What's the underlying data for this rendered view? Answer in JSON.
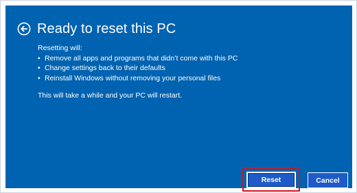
{
  "header": {
    "back_icon": "back-arrow-circle-icon",
    "title": "Ready to reset this PC"
  },
  "content": {
    "intro": "Resetting will:",
    "items": [
      "Remove all apps and programs that didn’t come with this PC",
      "Change settings back to their defaults",
      "Reinstall Windows without removing your personal files"
    ],
    "note": "This will take a while and your PC will restart."
  },
  "actions": {
    "reset_label": "Reset",
    "cancel_label": "Cancel"
  },
  "colors": {
    "panel_background": "#0063b1",
    "button_background": "#1e5ac8",
    "highlight_border": "#d8121b"
  }
}
